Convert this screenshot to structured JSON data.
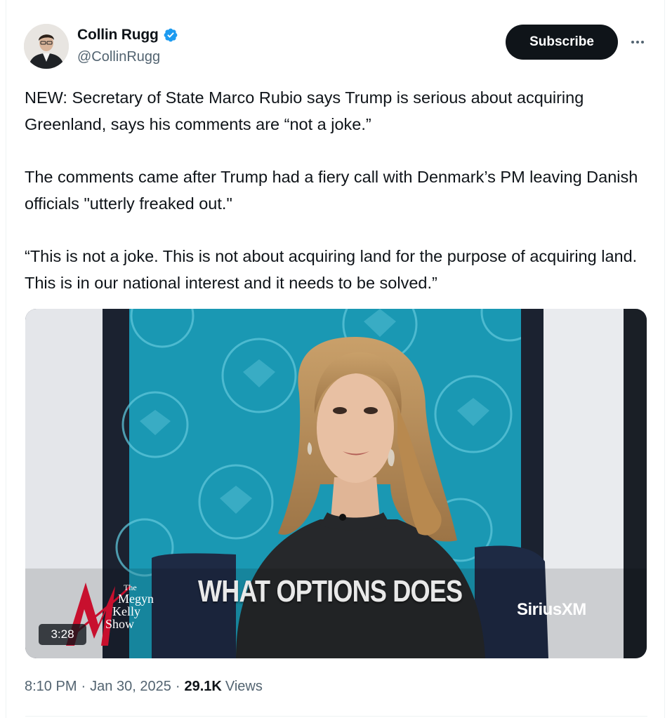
{
  "author": {
    "display_name": "Collin Rugg",
    "handle": "@CollinRugg",
    "verified_icon": "verified-badge-icon",
    "accent_color": "#1d9bf0"
  },
  "actions": {
    "subscribe_label": "Subscribe",
    "more_icon": "more-options-icon"
  },
  "tweet": {
    "paragraphs": [
      "NEW: Secretary of State Marco Rubio says Trump is serious about acquiring Greenland, says his comments are “not a joke.”",
      "The comments came after Trump had a fiery call with Denmark’s PM leaving Danish officials \"utterly freaked out.\"",
      "“This is not a joke. This is not about acquiring land for the purpose of acquiring land. This is in our national interest and it needs to be solved.”"
    ]
  },
  "media": {
    "caption": "WHAT OPTIONS DOES",
    "network_logo": "SiriusXM",
    "show_logo": {
      "the": "The",
      "line1": "Megyn",
      "line2": "Kelly",
      "line3": "Show"
    },
    "duration": "3:28"
  },
  "meta": {
    "time": "8:10 PM",
    "date": "Jan 30, 2025",
    "views_count": "29.1K",
    "views_label": "Views"
  },
  "colors": {
    "text_primary": "#0f1419",
    "text_secondary": "#536471",
    "backdrop_teal": "#1c9ab4"
  }
}
